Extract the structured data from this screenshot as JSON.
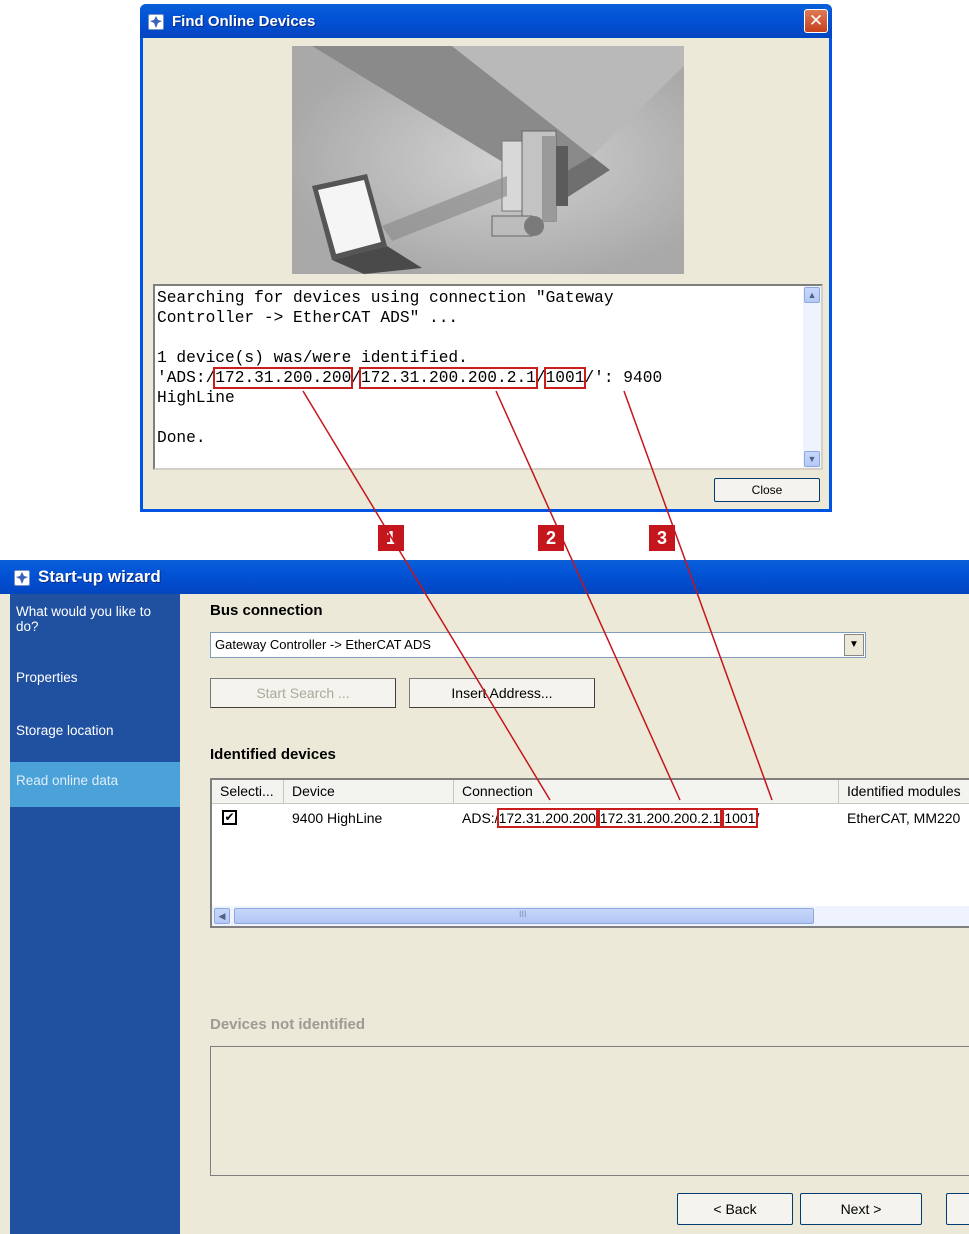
{
  "find_dialog": {
    "title": "Find Online Devices",
    "close_glyph": "✕",
    "log": {
      "line1": "Searching for devices using connection \"Gateway",
      "line2": "Controller -> EtherCAT ADS\" ...",
      "line3": "",
      "line4": "1 device(s) was/were identified.",
      "line5_prefix": "'ADS:/",
      "ip1": "172.31.200.200",
      "sep1": "/",
      "ip2": "172.31.200.200.2.1",
      "sep2": "/",
      "port": "1001",
      "line5_suffix": "/': 9400",
      "line6": "HighLine",
      "line7": "",
      "line8": "Done."
    },
    "close_button": "Close"
  },
  "callouts": [
    "1",
    "2",
    "3"
  ],
  "wizard": {
    "title": "Start-up wizard",
    "sidebar": [
      {
        "label": "What would you like to do?",
        "active": false
      },
      {
        "label": "Properties",
        "active": false
      },
      {
        "label": "Storage location",
        "active": false
      },
      {
        "label": "Read online data",
        "active": true
      }
    ],
    "bus_connection_label": "Bus connection",
    "connection_value": "Gateway Controller -> EtherCAT ADS",
    "start_search": "Start Search ...",
    "insert_address": "Insert Address...",
    "identified_label": "Identified devices",
    "table": {
      "headers": [
        "Selecti...",
        "Device",
        "Connection",
        "Identified modules"
      ],
      "row": {
        "checked": "✔",
        "device": "9400 HighLine",
        "conn_prefix": "ADS:/",
        "ip1": "172.31.200.200",
        "sep1": "/",
        "ip2": "172.31.200.200.2.1",
        "sep2": "/",
        "port": "1001",
        "suffix": "/",
        "modules": "EtherCAT, MM220"
      },
      "scroll_mark": "III"
    },
    "not_identified_label": "Devices not identified",
    "back_button": "< Back",
    "next_button": "Next >"
  },
  "colors": {
    "title_blue": "#0253d6",
    "sidebar_blue": "#2051a0",
    "sidebar_active": "#4aa2d8",
    "callout_red": "#c4161c",
    "dialog_bg": "#ece9d8"
  },
  "icons": [
    "app-icon",
    "close-x-icon",
    "scroll-up-icon",
    "scroll-down-icon",
    "dropdown-arrow-icon",
    "scroll-left-icon"
  ]
}
